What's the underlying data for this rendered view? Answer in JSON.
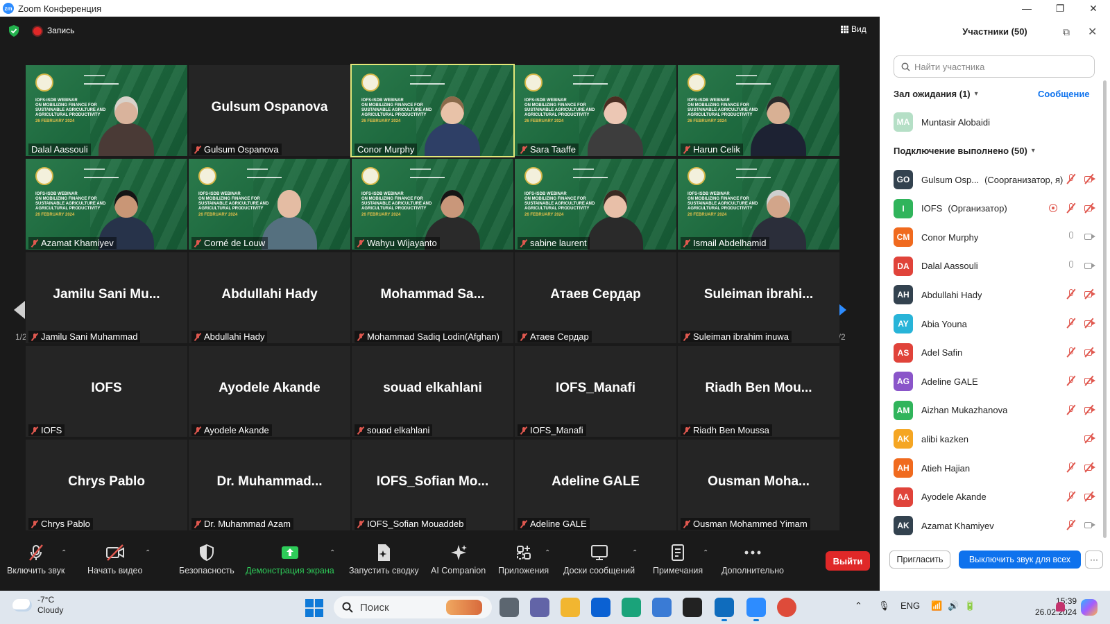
{
  "window": {
    "logo_text": "zm",
    "title": "Zoom Конференция",
    "minimize": "—",
    "restore": "❐",
    "close": "✕"
  },
  "topbar": {
    "record_label": "Запись",
    "view_label": "Вид"
  },
  "colors": {
    "panel_bg": "#ffffff",
    "meeting_bg": "#1a1a1a",
    "video_green": "#1f6b42",
    "active_outline": "#e3e87a",
    "mic_off_red": "#e0584f",
    "primary_blue": "#0e72ed",
    "leave_red": "#e02828",
    "share_green": "#2ecb59"
  },
  "tiles": [
    {
      "name": "Dalal Aassouli",
      "video": true,
      "muted": false,
      "active": false,
      "skin": "#d9b39c",
      "body": "#4a3a36",
      "hair": "#d8d2ca"
    },
    {
      "name": "Gulsum Ospanova",
      "big": "Gulsum Ospanova",
      "video": false,
      "muted": true
    },
    {
      "name": "Conor Murphy",
      "video": true,
      "muted": false,
      "active": true,
      "skin": "#e8c2a8",
      "body": "#2e3f66",
      "hair": "#8a6a4a"
    },
    {
      "name": "Sara Taaffe",
      "video": true,
      "muted": true,
      "active": false,
      "skin": "#ecc7b4",
      "body": "#3d3d3d",
      "hair": "#4a2e22"
    },
    {
      "name": "Harun Celik",
      "video": true,
      "muted": true,
      "active": false,
      "skin": "#d8b094",
      "body": "#1d2233",
      "hair": "#2a2a2a"
    },
    {
      "name": "Azamat Khamiyev",
      "video": true,
      "muted": true,
      "active": false,
      "skin": "#c99676",
      "body": "#27334a",
      "hair": "#151515"
    },
    {
      "name": "Corné de Louw",
      "video": true,
      "muted": true,
      "active": false,
      "skin": "#e4bca3",
      "body": "#55707f",
      "hair": "#e4bca3"
    },
    {
      "name": "Wahyu Wijayanto",
      "video": true,
      "muted": true,
      "active": false,
      "skin": "#c9977a",
      "body": "#2a2a2a",
      "hair": "#151515"
    },
    {
      "name": "sabine laurent",
      "video": true,
      "muted": true,
      "active": false,
      "skin": "#e8bfa8",
      "body": "#2a2a2a",
      "hair": "#3a2a22"
    },
    {
      "name": "Ismail Abdelhamid",
      "video": true,
      "muted": true,
      "active": false,
      "skin": "#d2a58a",
      "body": "#2b2e3a",
      "hair": "#cfcfcf"
    },
    {
      "name": "Jamilu Sani Muhammad",
      "big": "Jamilu  Sani  Mu...",
      "video": false,
      "muted": true
    },
    {
      "name": "Abdullahi Hady",
      "big": "Abdullahi Hady",
      "video": false,
      "muted": true
    },
    {
      "name": "Mohammad Sadiq Lodin(Afghan)",
      "big": "Mohammad  Sa...",
      "video": false,
      "muted": true
    },
    {
      "name": "Атаев Сердар",
      "big": "Атаев Сердар",
      "video": false,
      "muted": true
    },
    {
      "name": "Suleiman ibrahim inuwa",
      "big": "Suleiman  ibrahi...",
      "video": false,
      "muted": true
    },
    {
      "name": "IOFS",
      "big": "IOFS",
      "video": false,
      "muted": true
    },
    {
      "name": "Ayodele Akande",
      "big": "Ayodele Akande",
      "video": false,
      "muted": true
    },
    {
      "name": "souad elkahlani",
      "big": "souad elkahlani",
      "video": false,
      "muted": true
    },
    {
      "name": "IOFS_Manafi",
      "big": "IOFS_Manafi",
      "video": false,
      "muted": true
    },
    {
      "name": "Riadh Ben Moussa",
      "big": "Riadh  Ben  Mou...",
      "video": false,
      "muted": true
    },
    {
      "name": "Chrys Pablo",
      "big": "Chrys Pablo",
      "video": false,
      "muted": true
    },
    {
      "name": "Dr. Muhammad Azam",
      "big": "Dr.  Muhammad...",
      "video": false,
      "muted": true
    },
    {
      "name": "IOFS_Sofian Mouaddeb",
      "big": "IOFS_Sofian  Mo...",
      "video": false,
      "muted": true
    },
    {
      "name": "Adeline  GALE",
      "big": "Adeline  GALE",
      "video": false,
      "muted": true
    },
    {
      "name": "Ousman Mohammed Yimam",
      "big": "Ousman  Moha...",
      "video": false,
      "muted": true
    }
  ],
  "webinar_slide": {
    "line1": "IOFS-IsDB WEBINAR",
    "line2": "ON MOBILIZING FINANCE FOR SUSTAINABLE AGRICULTURE AND AGRICULTURAL PRODUCTIVITY",
    "date": "26 FEBRUARY 2024"
  },
  "pager": {
    "left": "1/2",
    "right": "1/2"
  },
  "toolbar": {
    "unmute": "Включить звук",
    "start_video": "Начать видео",
    "security": "Безопасность",
    "share": "Демонстрация экрана",
    "summary": "Запустить сводку",
    "ai": "AI Companion",
    "apps": "Приложения",
    "whiteboards": "Доски сообщений",
    "notes": "Примечания",
    "more": "Дополнительно",
    "leave": "Выйти"
  },
  "panel": {
    "title": "Участники (50)",
    "search_placeholder": "Найти участника",
    "waiting_room": "Зал ожидания (1)",
    "message": "Сообщение",
    "connected": "Подключение выполнено (50)",
    "waiting": [
      {
        "initials": "MA",
        "name": "Muntasir Alobaidi",
        "color": "#b5dfc6"
      }
    ],
    "participants": [
      {
        "initials": "GO",
        "name": "Gulsum Osp...",
        "role": "(Соорганизатор, я)",
        "color": "#33424f",
        "icons": [
          "mic-off",
          "cam-off"
        ]
      },
      {
        "initials": "I",
        "name": "IOFS",
        "role": "(Организатор)",
        "color": "#30b45b",
        "icons": [
          "rec",
          "mic-off",
          "cam-off"
        ]
      },
      {
        "initials": "CM",
        "name": "Conor Murphy",
        "role": "",
        "color": "#f06a1e",
        "icons": [
          "mic",
          "cam"
        ]
      },
      {
        "initials": "DA",
        "name": "Dalal Aassouli",
        "role": "",
        "color": "#e0433a",
        "icons": [
          "mic",
          "cam"
        ]
      },
      {
        "initials": "AH",
        "name": "Abdullahi Hady",
        "role": "",
        "color": "#33424f",
        "icons": [
          "mic-off",
          "cam-off"
        ]
      },
      {
        "initials": "AY",
        "name": "Abia Youna",
        "role": "",
        "color": "#28b4d8",
        "icons": [
          "mic-off",
          "cam-off"
        ]
      },
      {
        "initials": "AS",
        "name": "Adel Safin",
        "role": "",
        "color": "#e0433a",
        "icons": [
          "mic-off",
          "cam-off"
        ]
      },
      {
        "initials": "AG",
        "name": "Adeline  GALE",
        "role": "",
        "color": "#8a55c9",
        "icons": [
          "mic-off",
          "cam-off"
        ]
      },
      {
        "initials": "AM",
        "name": "Aizhan Mukazhanova",
        "role": "",
        "color": "#30b45b",
        "icons": [
          "mic-off",
          "cam-off"
        ]
      },
      {
        "initials": "AK",
        "name": "alibi kazken",
        "role": "",
        "color": "#f5a623",
        "icons": [
          "cam-off"
        ]
      },
      {
        "initials": "AH",
        "name": "Atieh Hajian",
        "role": "",
        "color": "#f06a1e",
        "icons": [
          "mic-off",
          "cam-off"
        ]
      },
      {
        "initials": "AA",
        "name": "Ayodele Akande",
        "role": "",
        "color": "#e0433a",
        "icons": [
          "mic-off",
          "cam-off"
        ]
      },
      {
        "initials": "AK",
        "name": "Azamat Khamiyev",
        "role": "",
        "color": "#33424f",
        "icons": [
          "mic-off",
          "cam"
        ]
      }
    ],
    "invite": "Пригласить",
    "mute_all": "Выключить звук для всех",
    "more": "···"
  },
  "taskbar": {
    "temp": "-7°C",
    "weather": "Cloudy",
    "search": "Поиск",
    "lang": "ENG",
    "time": "15:39",
    "date": "26.02.2024"
  }
}
